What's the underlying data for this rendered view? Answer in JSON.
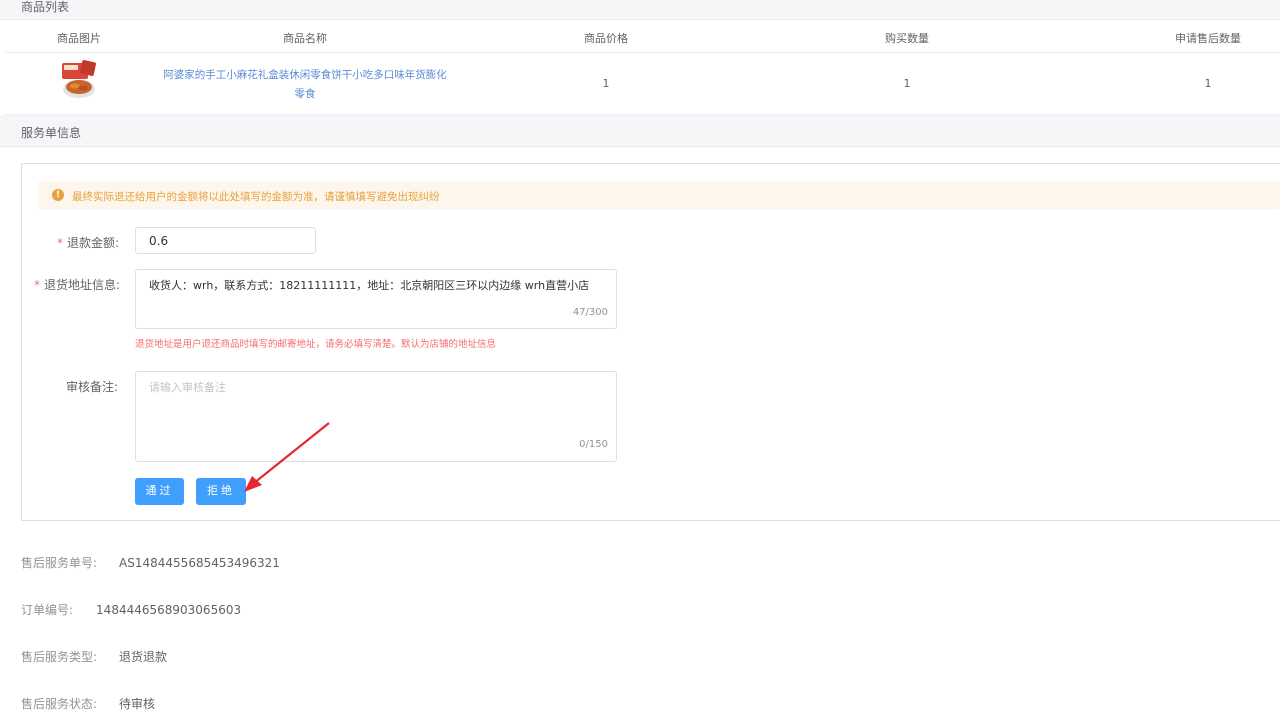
{
  "product_section": {
    "title": "商品列表"
  },
  "table": {
    "headers": [
      "商品图片",
      "商品名称",
      "商品价格",
      "购买数量",
      "申请售后数量"
    ],
    "rows": [
      {
        "name": "阿婆家的手工小麻花礼盒装休闲零食饼干小吃多口味年货膨化零食",
        "price": "1",
        "quantity": "1",
        "aftersale_quantity": "1"
      }
    ]
  },
  "service_section": {
    "title": "服务单信息"
  },
  "form": {
    "alert": "最终实际退还给用户的金额将以此处填写的金额为准，请谨慎填写避免出现纠纷",
    "refund_label": "退款金额:",
    "refund_value": "0.6",
    "address_label": "退货地址信息:",
    "address_value": "收货人：wrh，联系方式：18211111111，地址：北京朝阳区三环以内边缘 wrh直营小店",
    "address_count": "47/300",
    "address_hint": "退货地址是用户退还商品时填写的邮寄地址，请务必填写清楚。默认为店铺的地址信息",
    "remark_label": "审核备注:",
    "remark_placeholder": "请输入审核备注",
    "remark_count": "0/150",
    "approve_label": "通过",
    "reject_label": "拒绝"
  },
  "details": [
    {
      "key": "售后服务单号:",
      "value": "AS1484455685453496321"
    },
    {
      "key": "订单编号:",
      "value": "1484446568903065603"
    },
    {
      "key": "售后服务类型:",
      "value": "退货退款"
    },
    {
      "key": "售后服务状态:",
      "value": "待审核"
    }
  ],
  "colors": {
    "primary": "#409eff",
    "warning": "#e6a23c",
    "danger": "#f56c6c",
    "link": "#5b8bd6"
  }
}
